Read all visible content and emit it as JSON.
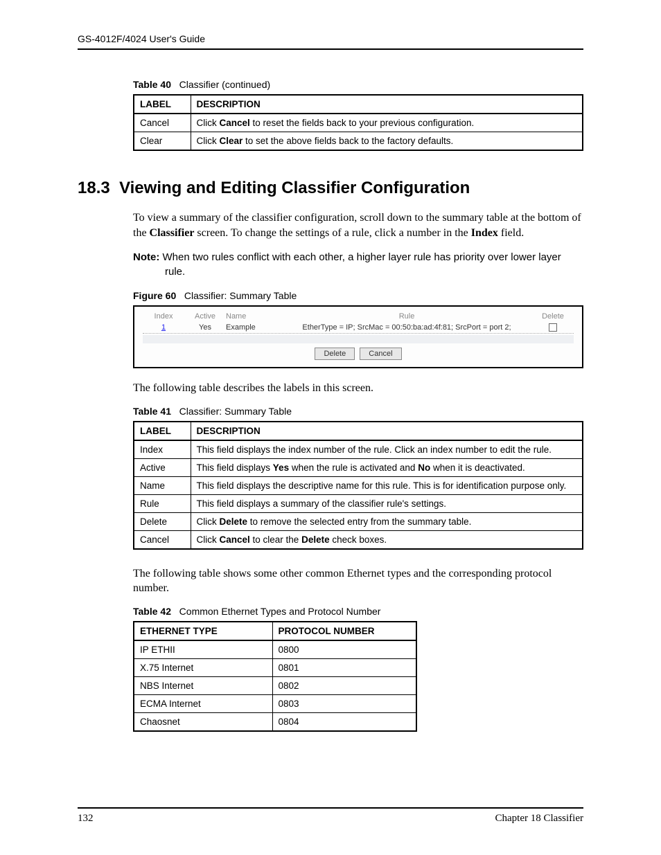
{
  "header": {
    "guide": "GS-4012F/4024 User's Guide"
  },
  "table40": {
    "caption_label": "Table 40",
    "caption_text": "Classifier  (continued)",
    "columns": [
      "LABEL",
      "DESCRIPTION"
    ],
    "rows": [
      {
        "label": "Cancel",
        "desc_pre": "Click ",
        "desc_b1": "Cancel",
        "desc_mid": " to reset the fields back to your previous configuration.",
        "desc_b2": "",
        "desc_post": ""
      },
      {
        "label": "Clear",
        "desc_pre": "Click ",
        "desc_b1": "Clear",
        "desc_mid": " to set the above fields back to the factory defaults.",
        "desc_b2": "",
        "desc_post": ""
      }
    ]
  },
  "section": {
    "number": "18.3",
    "title": "Viewing and Editing Classifier Configuration",
    "para1_pre": "To view a summary of the classifier configuration, scroll down to the summary table at the bottom of the ",
    "para1_b1": "Classifier",
    "para1_mid": " screen. To change the settings of a rule, click a number in the ",
    "para1_b2": "Index",
    "para1_post": " field.",
    "note_label": "Note:",
    "note_text": " When two rules conflict with each other, a higher layer rule has priority over lower layer rule."
  },
  "figure60": {
    "caption_label": "Figure 60",
    "caption_text": "Classifier: Summary Table",
    "columns": {
      "index": "Index",
      "active": "Active",
      "name": "Name",
      "rule": "Rule",
      "delete": "Delete"
    },
    "row": {
      "index": "1",
      "active": "Yes",
      "name": "Example",
      "rule": "EtherType = IP; SrcMac = 00:50:ba:ad:4f:81; SrcPort = port 2;"
    },
    "buttons": {
      "delete": "Delete",
      "cancel": "Cancel"
    }
  },
  "para_after_figure": "The following table describes the labels in this screen.",
  "table41": {
    "caption_label": "Table 41",
    "caption_text": "Classifier: Summary Table",
    "columns": [
      "LABEL",
      "DESCRIPTION"
    ],
    "rows": [
      {
        "label": "Index",
        "desc_pre": "This field displays the index number of the rule. Click an index number to edit the rule.",
        "desc_b1": "",
        "desc_mid": "",
        "desc_b2": "",
        "desc_post": ""
      },
      {
        "label": "Active",
        "desc_pre": "This field displays ",
        "desc_b1": "Yes",
        "desc_mid": " when the rule is activated and ",
        "desc_b2": "No",
        "desc_post": " when it is deactivated."
      },
      {
        "label": "Name",
        "desc_pre": "This field displays the descriptive name for this rule. This is for identification purpose only.",
        "desc_b1": "",
        "desc_mid": "",
        "desc_b2": "",
        "desc_post": ""
      },
      {
        "label": "Rule",
        "desc_pre": "This field displays a summary of the classifier rule's settings.",
        "desc_b1": "",
        "desc_mid": "",
        "desc_b2": "",
        "desc_post": ""
      },
      {
        "label": "Delete",
        "desc_pre": "Click ",
        "desc_b1": "Delete",
        "desc_mid": " to remove the selected entry from the summary table.",
        "desc_b2": "",
        "desc_post": ""
      },
      {
        "label": "Cancel",
        "desc_pre": "Click ",
        "desc_b1": "Cancel",
        "desc_mid": " to clear the ",
        "desc_b2": "Delete",
        "desc_post": " check boxes."
      }
    ]
  },
  "para_before_42": "The following table shows some other common Ethernet types and the corresponding protocol number.",
  "table42": {
    "caption_label": "Table 42",
    "caption_text": "Common Ethernet Types and Protocol Number",
    "columns": [
      "ETHERNET TYPE",
      "PROTOCOL NUMBER"
    ],
    "rows": [
      {
        "type": "IP ETHII",
        "proto": "0800"
      },
      {
        "type": "X.75 Internet",
        "proto": "0801"
      },
      {
        "type": "NBS Internet",
        "proto": "0802"
      },
      {
        "type": "ECMA Internet",
        "proto": "0803"
      },
      {
        "type": "Chaosnet",
        "proto": "0804"
      }
    ]
  },
  "footer": {
    "page": "132",
    "chapter": "Chapter 18 Classifier"
  }
}
